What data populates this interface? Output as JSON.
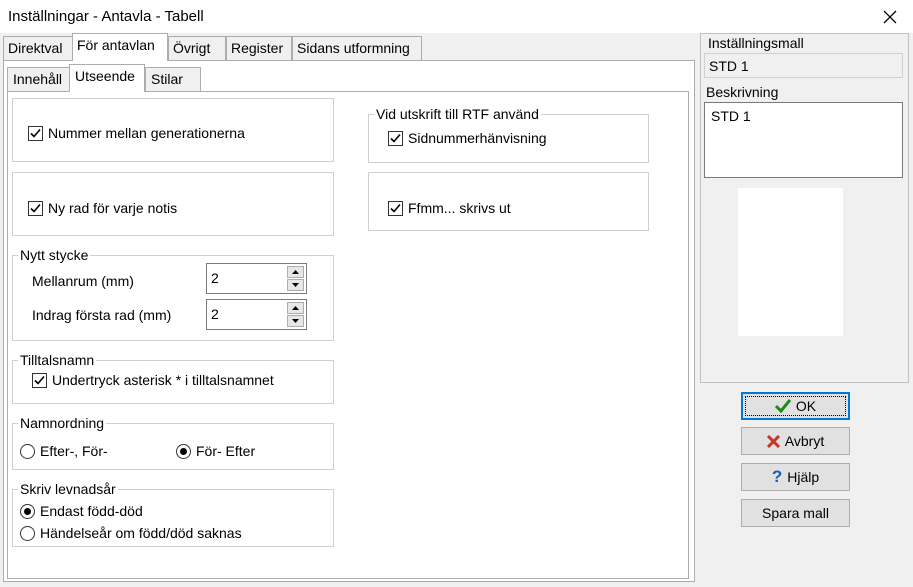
{
  "window": {
    "title": "Inställningar - Antavla - Tabell"
  },
  "tabs": [
    "Direktval",
    "För antavlan",
    "Övrigt",
    "Register",
    "Sidans utformning"
  ],
  "subtabs": [
    "Innehåll",
    "Utseende",
    "Stilar"
  ],
  "left": {
    "nummer_mellan": {
      "label": "Nummer mellan generationerna",
      "checked": true
    },
    "ny_rad": {
      "label": "Ny rad för varje notis",
      "checked": true
    },
    "nytt_stycke": {
      "title": "Nytt stycke",
      "mellanrum_label": "Mellanrum (mm)",
      "mellanrum_value": "2",
      "indrag_label": "Indrag första rad (mm)",
      "indrag_value": "2"
    },
    "tilltalsnamn": {
      "title": "Tilltalsnamn",
      "undertryck_label": "Undertryck asterisk * i tilltalsnamnet",
      "checked": true
    },
    "namnordning": {
      "title": "Namnordning",
      "option1": "Efter-, För-",
      "option2": "För- Efter",
      "selected": "option2"
    },
    "levnadsar": {
      "title": "Skriv levnadsår",
      "option1": "Endast född-död",
      "option2": "Händelseår om född/död saknas",
      "selected": "option1"
    }
  },
  "rtf": {
    "title": "Vid utskrift till RTF använd",
    "sidnummer_label": "Sidnummerhänvisning",
    "sidnummer_checked": true,
    "ffmm_label": "Ffmm... skrivs ut",
    "ffmm_checked": true
  },
  "right": {
    "mall_label": "Inställningsmall",
    "mall_value": "STD 1",
    "beskrivning_label": "Beskrivning",
    "beskrivning_value": "STD 1"
  },
  "buttons": {
    "ok": "OK",
    "avbryt": "Avbryt",
    "hjalp": "Hjälp",
    "spara": "Spara mall"
  },
  "colors": {
    "ok_check": "#1e8a1e",
    "cancel_x": "#c0392b",
    "help_q": "#1060c0",
    "focus": "#0078d7"
  }
}
